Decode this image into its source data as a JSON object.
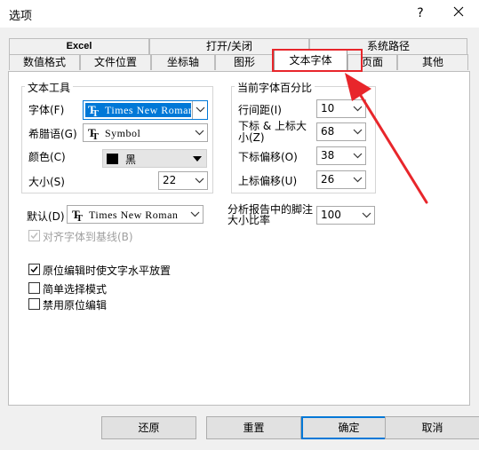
{
  "window": {
    "title": "选项",
    "help": "?",
    "close": "close"
  },
  "tabs": {
    "row1": [
      "Excel",
      "打开/关闭",
      "系统路径"
    ],
    "row2": [
      "数值格式",
      "文件位置",
      "坐标轴",
      "图形",
      "文本字体",
      "页面",
      "其他"
    ],
    "active": "文本字体"
  },
  "text_tool": {
    "title": "文本工具",
    "font_label": "字体(F)",
    "font_value": "Times New Roman",
    "greek_label": "希腊语(G)",
    "greek_value": "Symbol",
    "color_label": "颜色(C)",
    "color_value": "黑",
    "color_swatch": "#000000",
    "size_label": "大小(S)",
    "size_value": "22"
  },
  "percent": {
    "title": "当前字体百分比",
    "line_spacing_label": "行间距(I)",
    "line_spacing_value": "10",
    "subsup_label": "下标 & 上标大小(Z)",
    "subsup_value": "68",
    "sub_offset_label": "下标偏移(O)",
    "sub_offset_value": "38",
    "sup_offset_label": "上标偏移(U)",
    "sup_offset_value": "26"
  },
  "default_font": {
    "label": "默认(D)",
    "value": "Times New Roman"
  },
  "footnote": {
    "label": "分析报告中的脚注大小比率",
    "value": "100"
  },
  "checkboxes": [
    {
      "label": "对齐字体到基线(B)",
      "checked": true,
      "disabled": true
    },
    {
      "label": "原位编辑时使文字水平放置",
      "checked": true,
      "disabled": false
    },
    {
      "label": "简单选择模式",
      "checked": false,
      "disabled": false
    },
    {
      "label": "禁用原位编辑",
      "checked": false,
      "disabled": false
    }
  ],
  "buttons": {
    "restore": "还原",
    "reset": "重置",
    "ok": "确定",
    "cancel": "取消"
  },
  "annotation": {
    "color": "#e8262b"
  }
}
